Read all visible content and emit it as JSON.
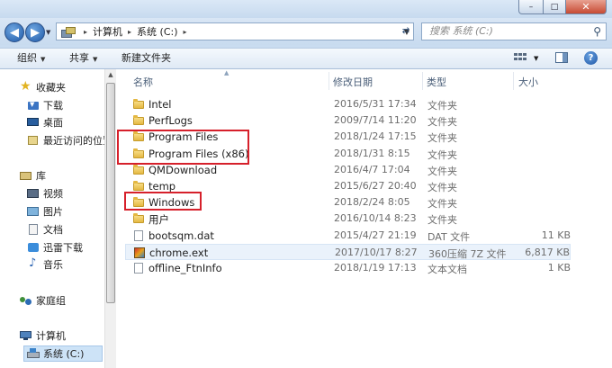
{
  "window": {
    "min_glyph": "–",
    "max_glyph": "□",
    "close_glyph": "✕"
  },
  "address": {
    "crumbs": [
      "计算机",
      "系统 (C:)"
    ],
    "separator": "▸",
    "search_placeholder": "搜索 系统 (C:)"
  },
  "toolbar": {
    "organize_label": "组织",
    "share_label": "共享",
    "newfolder_label": "新建文件夹"
  },
  "nav": {
    "favorites": "收藏夹",
    "downloads": "下载",
    "desktop": "桌面",
    "recent": "最近访问的位置",
    "libraries": "库",
    "videos": "视频",
    "pictures": "图片",
    "documents": "文档",
    "thunder": "迅雷下载",
    "music": "音乐",
    "homegroup": "家庭组",
    "computer": "计算机",
    "system_c": "系统 (C:)"
  },
  "columns": {
    "name": "名称",
    "date": "修改日期",
    "type": "类型",
    "size": "大小"
  },
  "files": [
    {
      "name": "Intel",
      "date": "2016/5/31 17:34",
      "type": "文件夹",
      "size": "",
      "icon": "folder"
    },
    {
      "name": "PerfLogs",
      "date": "2009/7/14 11:20",
      "type": "文件夹",
      "size": "",
      "icon": "folder"
    },
    {
      "name": "Program Files",
      "date": "2018/1/24 17:15",
      "type": "文件夹",
      "size": "",
      "icon": "folder"
    },
    {
      "name": "Program Files (x86)",
      "date": "2018/1/31 8:15",
      "type": "文件夹",
      "size": "",
      "icon": "folder"
    },
    {
      "name": "QMDownload",
      "date": "2016/4/7 17:04",
      "type": "文件夹",
      "size": "",
      "icon": "folder"
    },
    {
      "name": "temp",
      "date": "2015/6/27 20:40",
      "type": "文件夹",
      "size": "",
      "icon": "folder"
    },
    {
      "name": "Windows",
      "date": "2018/2/24 8:05",
      "type": "文件夹",
      "size": "",
      "icon": "folder"
    },
    {
      "name": "用户",
      "date": "2016/10/14 8:23",
      "type": "文件夹",
      "size": "",
      "icon": "folder"
    },
    {
      "name": "bootsqm.dat",
      "date": "2015/4/27 21:19",
      "type": "DAT 文件",
      "size": "11 KB",
      "icon": "file"
    },
    {
      "name": "chrome.ext",
      "date": "2017/10/17 8:27",
      "type": "360压缩 7Z 文件",
      "size": "6,817 KB",
      "icon": "archive"
    },
    {
      "name": "offline_FtnInfo",
      "date": "2018/1/19 17:13",
      "type": "文本文档",
      "size": "1 KB",
      "icon": "file"
    }
  ],
  "highlighted_row": 9,
  "colors": {
    "annotation_red": "#d6202b",
    "selection": "#cde3f7"
  }
}
